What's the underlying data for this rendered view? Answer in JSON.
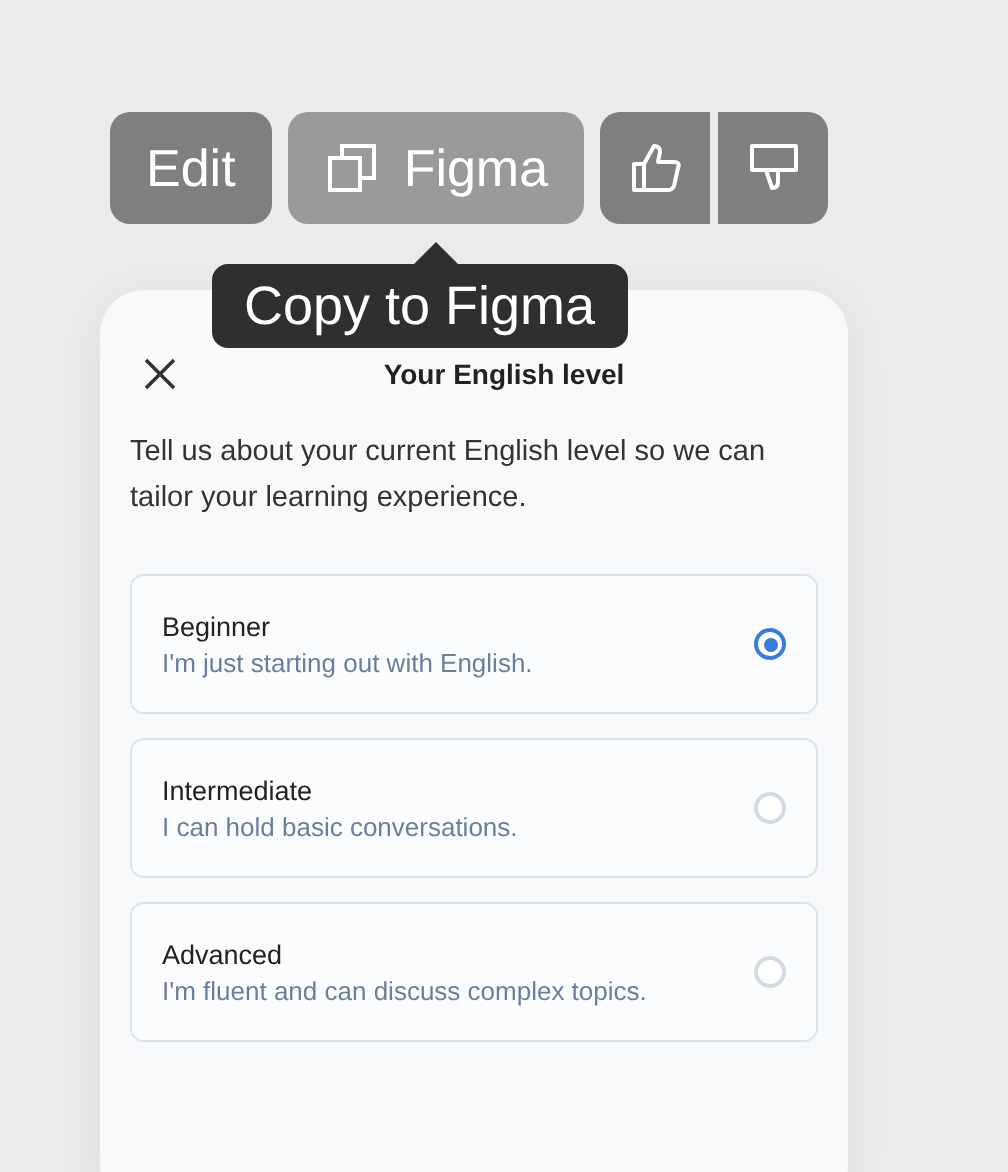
{
  "toolbar": {
    "edit": "Edit",
    "figma": "Figma"
  },
  "tooltip": "Copy to Figma",
  "dialog": {
    "title": "Your English level",
    "description": "Tell us about your current English level so we can tailor your learning experience.",
    "options": [
      {
        "label": "Beginner",
        "hint": "I'm just starting out with English.",
        "selected": true
      },
      {
        "label": "Intermediate",
        "hint": "I can hold basic conversations.",
        "selected": false
      },
      {
        "label": "Advanced",
        "hint": "I'm fluent and can discuss complex topics.",
        "selected": false
      }
    ]
  }
}
